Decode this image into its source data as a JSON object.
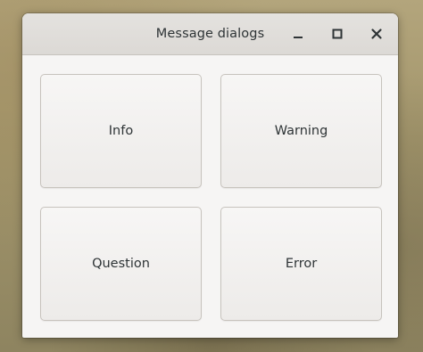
{
  "window": {
    "title": "Message dialogs",
    "controls": {
      "minimize_icon": "minimize-icon",
      "maximize_icon": "maximize-icon",
      "close_icon": "close-icon"
    }
  },
  "buttons": {
    "info": "Info",
    "warning": "Warning",
    "question": "Question",
    "error": "Error"
  },
  "colors": {
    "titlebar": "#dcd9d5",
    "window_bg": "#f6f5f4",
    "text": "#2e3436",
    "button_border": "#c7c3bd"
  }
}
